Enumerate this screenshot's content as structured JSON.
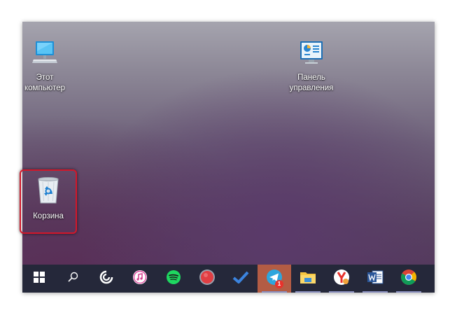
{
  "desktop": {
    "icons": [
      {
        "label": "Этот\nкомпьютер",
        "icon": "computer-icon"
      },
      {
        "label": "Панель\nуправления",
        "icon": "control-panel-icon"
      },
      {
        "label": "Корзина",
        "icon": "recycle-bin-icon"
      }
    ],
    "highlight_color": "#d2172a"
  },
  "taskbar": {
    "items": [
      {
        "name": "start-button",
        "icon": "windows-logo-icon"
      },
      {
        "name": "search-button",
        "icon": "search-icon"
      },
      {
        "name": "taskbar-app-cortana",
        "icon": "cortana-icon"
      },
      {
        "name": "taskbar-app-itunes",
        "icon": "itunes-icon"
      },
      {
        "name": "taskbar-app-spotify",
        "icon": "spotify-icon"
      },
      {
        "name": "taskbar-app-recorder",
        "icon": "red-circle-icon"
      },
      {
        "name": "taskbar-app-todo",
        "icon": "checkmark-icon"
      },
      {
        "name": "taskbar-app-telegram",
        "icon": "telegram-icon",
        "badge": "1"
      },
      {
        "name": "taskbar-app-explorer",
        "icon": "folder-icon"
      },
      {
        "name": "taskbar-app-yandex",
        "icon": "yandex-browser-icon"
      },
      {
        "name": "taskbar-app-word",
        "icon": "word-icon"
      },
      {
        "name": "taskbar-app-chrome",
        "icon": "chrome-icon"
      }
    ],
    "background": "#25283a",
    "active_color": "#b35c44"
  }
}
